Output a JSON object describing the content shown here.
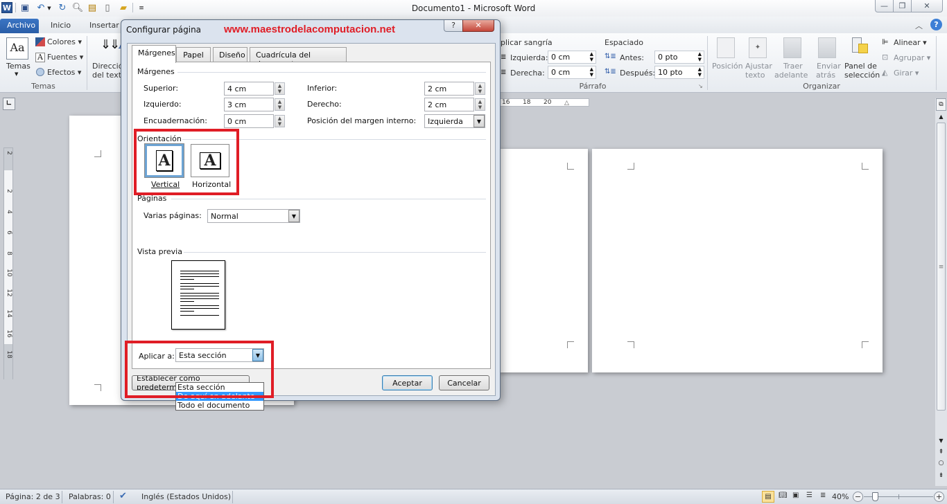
{
  "window": {
    "title": "Documento1  -  Microsoft Word",
    "app_icon": "word-icon",
    "quick_access": [
      "save-icon",
      "undo-icon",
      "undo-dropdown-icon",
      "redo-icon",
      "print-preview-icon",
      "insert-picture-icon",
      "new-document-icon",
      "open-folder-icon",
      "customize-qat-icon"
    ],
    "controls": {
      "minimize": "—",
      "restore": "❐",
      "close": "✕"
    }
  },
  "ribbon": {
    "tabs": [
      {
        "label": "Archivo",
        "active": false,
        "file": true
      },
      {
        "label": "Inicio"
      },
      {
        "label": "Insertar"
      }
    ],
    "groups": {
      "temas": {
        "label": "Temas",
        "temas_button": "Temas",
        "colores": "Colores",
        "fuentes": "Fuentes",
        "efectos": "Efectos",
        "direccion_line1": "Dirección",
        "direccion_line2": "del texto"
      },
      "parrafo": {
        "label": "Párrafo",
        "aplicar_sangria": "plicar sangría",
        "izquierda_label": "Izquierda:",
        "izquierda_value": "0 cm",
        "derecha_label": "Derecha:",
        "derecha_value": "0 cm",
        "espaciado": "Espaciado",
        "antes_label": "Antes:",
        "antes_value": "0 pto",
        "despues_label": "Después:",
        "despues_value": "10 pto"
      },
      "organizar": {
        "label": "Organizar",
        "posicion": "Posición",
        "ajustar1": "Ajustar",
        "ajustar2": "texto",
        "traer1": "Traer",
        "traer2": "adelante",
        "enviar1": "Enviar",
        "enviar2": "atrás",
        "panel1": "Panel de",
        "panel2": "selección",
        "alinear": "Alinear",
        "agrupar": "Agrupar",
        "girar": "Girar"
      }
    }
  },
  "ruler": {
    "horizontal_ticks": [
      "16",
      "18",
      "20"
    ],
    "vertical_ticks": [
      "2",
      "2",
      "4",
      "6",
      "8",
      "10",
      "12",
      "14",
      "16",
      "18"
    ]
  },
  "dialog": {
    "title": "Configurar página",
    "watermark": "www.maestrodelacomputacion.net",
    "watermark_color": "#e01d26",
    "help_button": "?",
    "close_button": "✕",
    "tabs": [
      {
        "label": "Márgenes",
        "active": true
      },
      {
        "label": "Papel"
      },
      {
        "label": "Diseño"
      },
      {
        "label": "Cuadrícula del documento"
      }
    ],
    "margins": {
      "legend": "Márgenes",
      "superior_label": "Superior:",
      "superior_value": "4 cm",
      "inferior_label": "Inferior:",
      "inferior_value": "2 cm",
      "izquierdo_label": "Izquierdo:",
      "izquierdo_value": "3 cm",
      "derecho_label": "Derecho:",
      "derecho_value": "2 cm",
      "encuadernacion_label": "Encuadernación:",
      "encuadernacion_value": "0 cm",
      "posicion_label": "Posición del margen interno:",
      "posicion_value": "Izquierda"
    },
    "orientation": {
      "legend": "Orientación",
      "vertical": "Vertical",
      "horizontal": "Horizontal",
      "selected": "Vertical",
      "glyph": "A"
    },
    "pages": {
      "legend": "Páginas",
      "varias_label": "Varias páginas:",
      "varias_value": "Normal"
    },
    "preview": {
      "legend": "Vista previa"
    },
    "apply": {
      "label": "Aplicar a:",
      "value": "Esta sección",
      "options": [
        "Esta sección",
        "De aquí en adelante",
        "Todo el documento"
      ],
      "highlighted": "De aquí en adelante"
    },
    "buttons": {
      "default": "Establecer como predeterminado",
      "default_visible": "Establecer c",
      "ok": "Aceptar",
      "cancel": "Cancelar"
    },
    "highlight_color": "#e01d26"
  },
  "status_bar": {
    "page": "Página: 2 de 3",
    "words": "Palabras: 0",
    "language": "Inglés (Estados Unidos)",
    "zoom": "40%",
    "zoom_percent": 40
  }
}
